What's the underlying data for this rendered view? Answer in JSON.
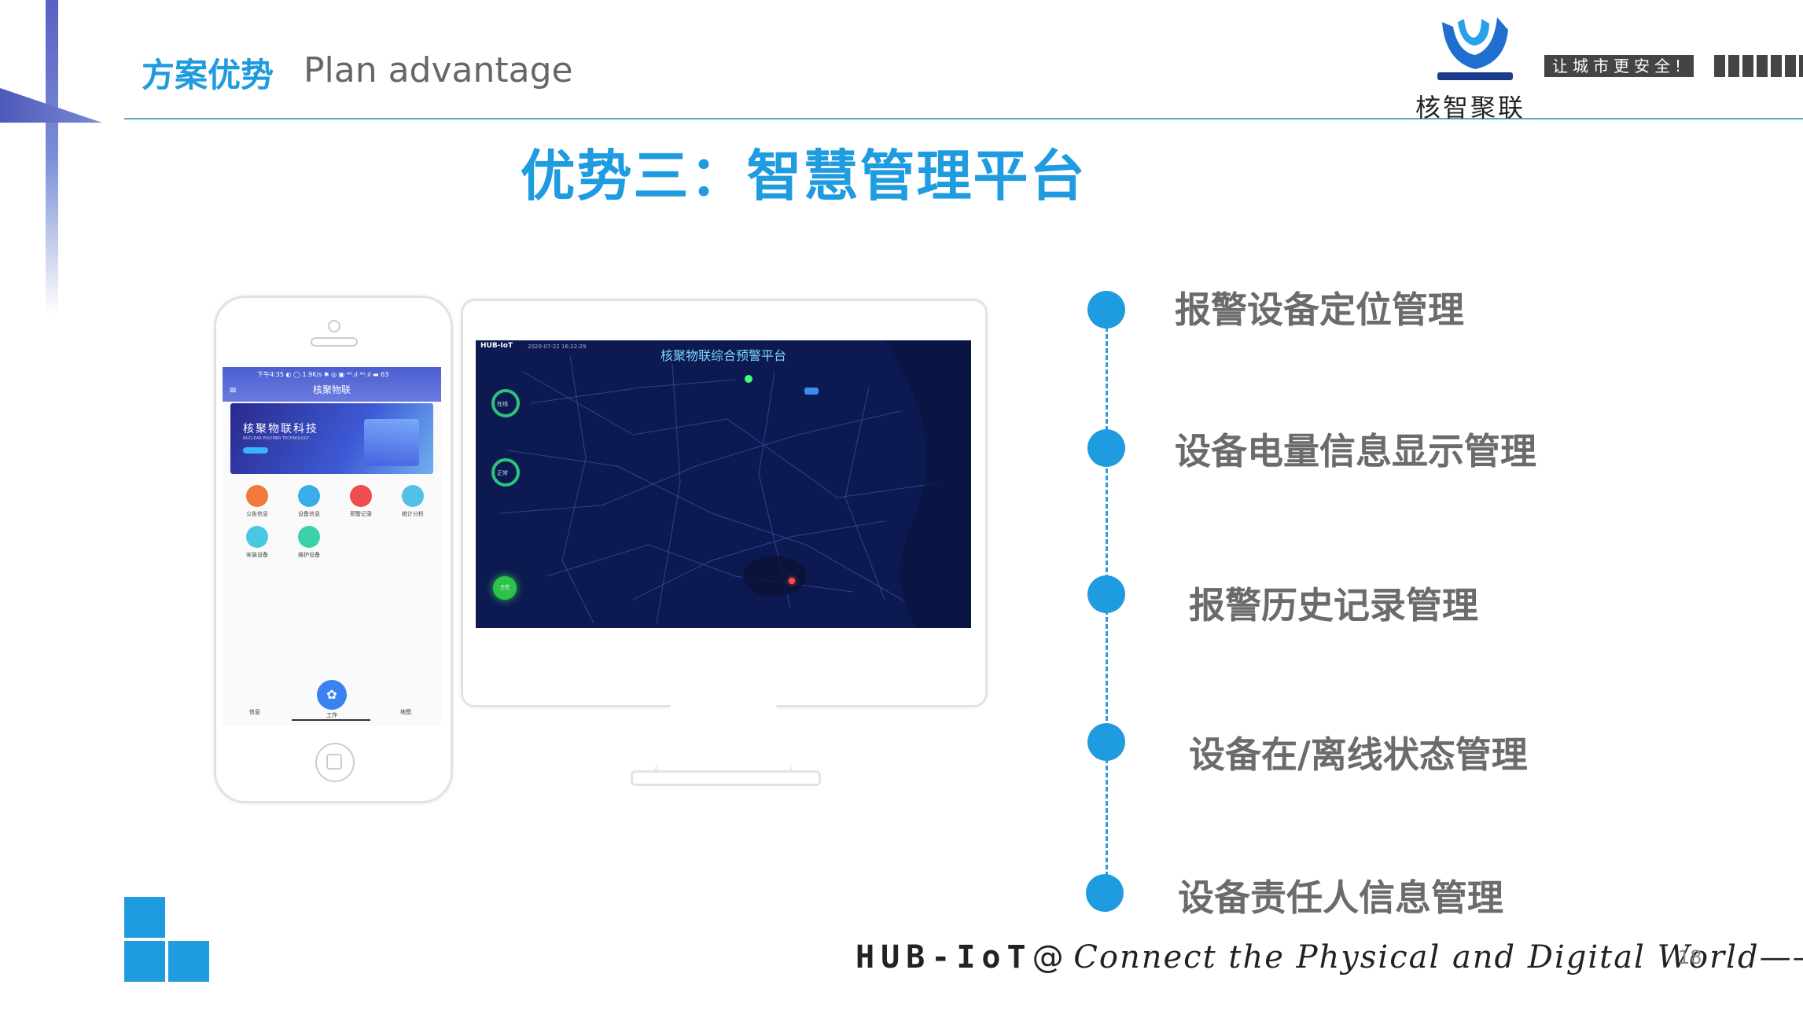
{
  "header": {
    "section_cn": "方案优势",
    "section_en": "Plan advantage",
    "logo_text": "核智聚联",
    "slogan": "让城市更安全!"
  },
  "title": "优势三：智慧管理平台",
  "phone": {
    "status": "下午4:35 ◐ ◯  1.9K/s ✱ ◎ ▣ ⁴ᴳ.ıl ⁴ᴳ.ıl ▬ 63",
    "app_name": "核聚物联",
    "banner_title": "核聚物联科技",
    "banner_sub": "NUCLEAR POLYMER TECHNOLOGY",
    "icons": [
      {
        "label": "公告信息",
        "color": "#f07a3a"
      },
      {
        "label": "设备信息",
        "color": "#3aaee8"
      },
      {
        "label": "预警记录",
        "color": "#f04e4e"
      },
      {
        "label": "统计分析",
        "color": "#52c1e8"
      },
      {
        "label": "安装设备",
        "color": "#4ac8e0"
      },
      {
        "label": "维护设备",
        "color": "#3ad0a8"
      }
    ],
    "tabs": {
      "left": "信息",
      "center": "工作",
      "right": "地图"
    }
  },
  "monitor": {
    "map_title": "核聚物联综合预警平台",
    "hub_label": "HUB-IoT",
    "date": "2020-07-22 16:22:29",
    "ring1_label": "在线",
    "ring2_label": "正常",
    "green_label": "主控"
  },
  "features": [
    "报警设备定位管理",
    "设备电量信息显示管理",
    "报警历史记录管理",
    "设备在/离线状态管理",
    "设备责任人信息管理"
  ],
  "footer": {
    "brand": "HUB-IoT",
    "at": "@",
    "tagline": "Connect the Physical and Digital World——",
    "page": "18"
  },
  "colors": {
    "accent": "#1f9be0",
    "feature_text": "#6b6b6b"
  }
}
